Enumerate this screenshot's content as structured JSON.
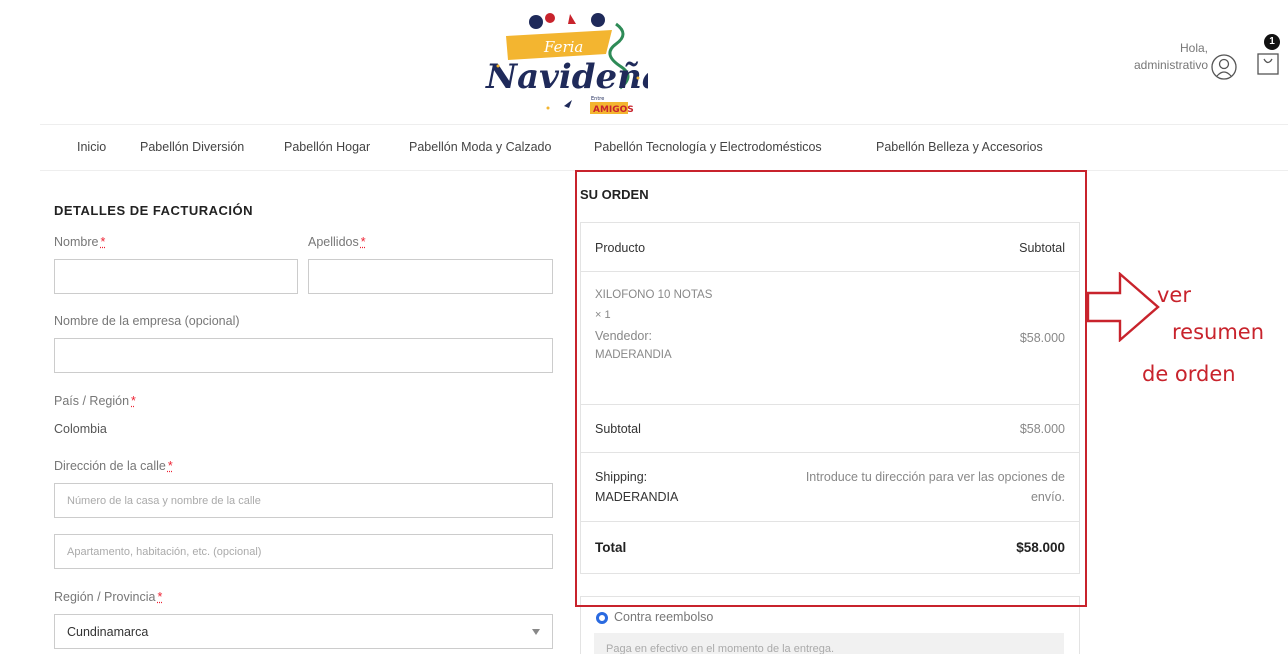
{
  "header": {
    "logo_texts": [
      "Feria",
      "Navideña",
      "Entre",
      "AMIGOS"
    ],
    "greeting_line1": "Hola,",
    "greeting_line2": "administrativo",
    "cart_count": "1"
  },
  "nav": {
    "items": [
      "Inicio",
      "Pabellón Diversión",
      "Pabellón Hogar",
      "Pabellón Moda y Calzado",
      "Pabellón Tecnología y Electrodomésticos",
      "Pabellón Belleza y Accesorios"
    ]
  },
  "billing": {
    "title": "DETALLES DE FACTURACIÓN",
    "first_name_label": "Nombre",
    "last_name_label": "Apellidos",
    "company_label": "Nombre de la empresa (opcional)",
    "country_label": "País / Región",
    "country_value": "Colombia",
    "street_label": "Dirección de la calle",
    "street_placeholder": "Número de la casa y nombre de la calle",
    "apartment_placeholder": "Apartamento, habitación, etc. (opcional)",
    "region_label": "Región / Provincia",
    "region_value": "Cundinamarca",
    "required_mark": "*"
  },
  "order": {
    "title": "SU ORDEN",
    "col_product": "Producto",
    "col_subtotal": "Subtotal",
    "item_name": "XILOFONO 10 NOTAS",
    "item_qty": "× 1",
    "vendor_label": "Vendedor:",
    "vendor_name": "MADERANDIA",
    "item_price": "$58.000",
    "subtotal_label": "Subtotal",
    "subtotal_value": "$58.000",
    "shipping_label": "Shipping:",
    "shipping_vendor": "MADERANDIA",
    "shipping_note_line1": "Introduce tu dirección para ver las opciones de",
    "shipping_note_line2": "envío.",
    "total_label": "Total",
    "total_value": "$58.000"
  },
  "payment": {
    "method_label": "Contra reembolso",
    "method_desc": "Paga en efectivo en el momento de la entrega."
  },
  "annotation": {
    "line1": "ver",
    "line2": "resumen",
    "line3": "de orden"
  },
  "colors": {
    "annotation_red": "#c8232c",
    "radio_blue": "#2a6ae0",
    "logo_yellow": "#f3b530",
    "logo_navy": "#1f2a5a",
    "logo_green": "#2e8b57"
  }
}
